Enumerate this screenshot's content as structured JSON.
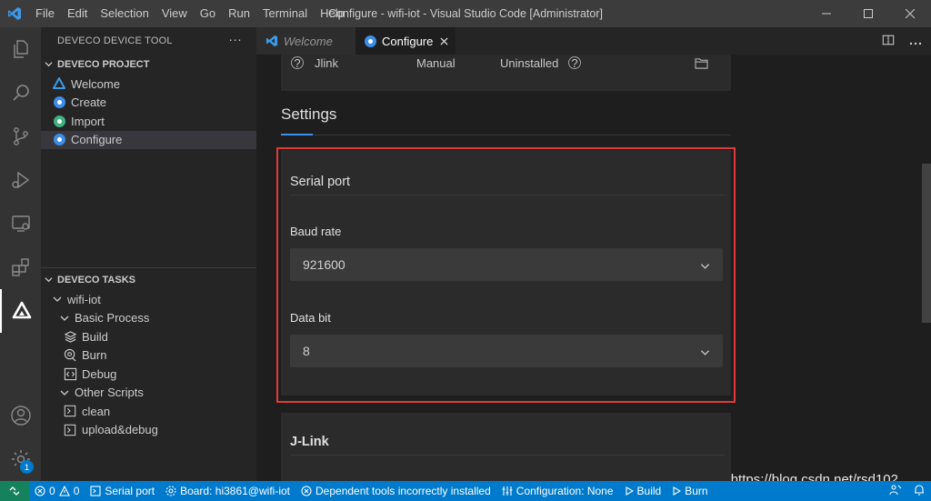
{
  "window": {
    "title": "Configure - wifi-iot - Visual Studio Code [Administrator]",
    "menu": [
      "File",
      "Edit",
      "Selection",
      "View",
      "Go",
      "Run",
      "Terminal",
      "Help"
    ]
  },
  "sidebar": {
    "header": "DEVECO DEVICE TOOL",
    "more": "···",
    "project": {
      "title": "DEVECO PROJECT",
      "items": [
        {
          "label": "Welcome",
          "icon": "deveco-logo-icon"
        },
        {
          "label": "Create",
          "icon": "circle-blue-icon"
        },
        {
          "label": "Import",
          "icon": "circle-green-icon"
        },
        {
          "label": "Configure",
          "icon": "circle-blue-icon"
        }
      ]
    },
    "tasks": {
      "title": "DEVECO TASKS",
      "root": "wifi-iot",
      "basic": "Basic Process",
      "basic_items": [
        {
          "label": "Build",
          "icon": "layers-icon"
        },
        {
          "label": "Burn",
          "icon": "burn-icon"
        },
        {
          "label": "Debug",
          "icon": "code-icon"
        }
      ],
      "other": "Other Scripts",
      "other_items": [
        {
          "label": "clean"
        },
        {
          "label": "upload&debug"
        }
      ]
    }
  },
  "tabs": [
    {
      "label": "Welcome",
      "active": false
    },
    {
      "label": "Configure",
      "active": true
    }
  ],
  "editor": {
    "jlink_row": {
      "name": "Jlink",
      "mode": "Manual",
      "status": "Uninstalled"
    },
    "settings_title": "Settings",
    "serial": {
      "title": "Serial port",
      "baud_label": "Baud rate",
      "baud_value": "921600",
      "databit_label": "Data bit",
      "databit_value": "8"
    },
    "jlink_section": "J-Link"
  },
  "statusbar": {
    "errors": "0",
    "warnings": "0",
    "serial_port": "Serial port",
    "board": "Board: hi3861@wifi-iot",
    "tools": "Dependent tools incorrectly installed",
    "configuration": "Configuration: None",
    "build": "Build",
    "burn": "Burn"
  },
  "activitybar": {
    "settings_badge": "1"
  },
  "watermark": "https://blog.csdn.net/rsd102",
  "colors": {
    "accent": "#007acc",
    "highlight": "#e03a3a",
    "remote": "#16825d"
  }
}
